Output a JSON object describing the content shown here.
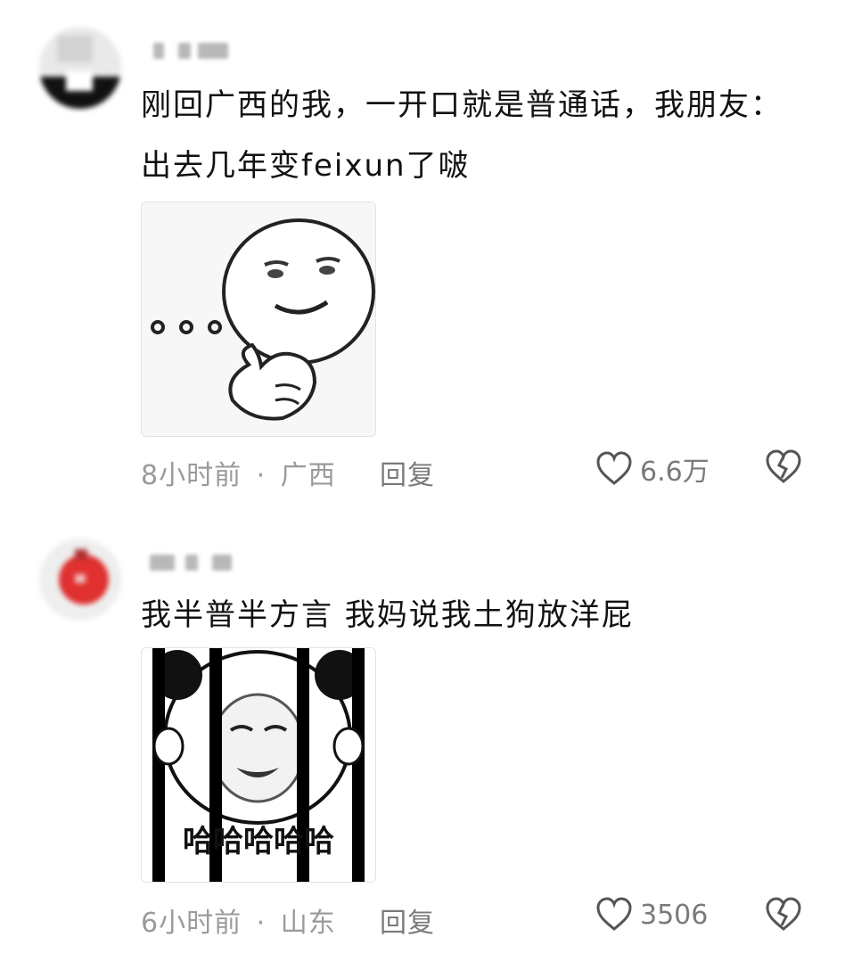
{
  "comments": [
    {
      "text": "刚回广西的我，一开口就是普通话，我朋友：出去几年变feixun了啵",
      "sticker_icon": "thinking-face-sticker",
      "time": "8小时前",
      "separator": "·",
      "location": "广西",
      "reply_label": "回复",
      "like_count": "6.6万"
    },
    {
      "text": "我半普半方言 我妈说我土狗放洋屁",
      "sticker_icon": "panda-jail-laughing-sticker",
      "sticker_caption": "哈哈哈哈哈",
      "time": "6小时前",
      "separator": "·",
      "location": "山东",
      "reply_label": "回复",
      "like_count": "3506"
    }
  ],
  "colors": {
    "text": "#111111",
    "meta": "#9a9a9a",
    "action": "#7a7a7a"
  }
}
